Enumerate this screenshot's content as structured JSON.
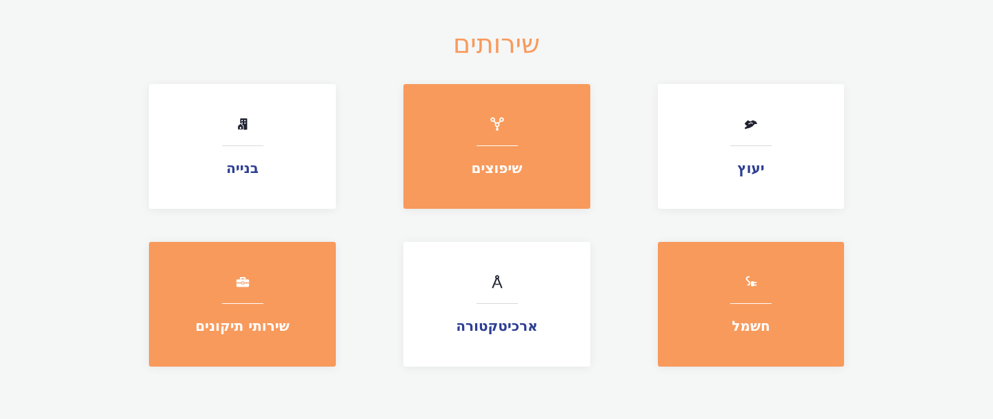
{
  "section": {
    "title": "שירותים"
  },
  "colors": {
    "accent": "#f89a5c",
    "title_blue": "#2d3e93",
    "card_white": "#ffffff",
    "background": "#f5f6f6"
  },
  "services": [
    {
      "title": "בנייה",
      "icon": "building-icon",
      "style": "white"
    },
    {
      "title": "שיפוצים",
      "icon": "nodes-icon",
      "style": "accent"
    },
    {
      "title": "יעוץ",
      "icon": "handshake-icon",
      "style": "white"
    },
    {
      "title": "שירותי תיקונים",
      "icon": "toolbox-icon",
      "style": "accent"
    },
    {
      "title": "ארכיטקטורה",
      "icon": "drafting-compass-icon",
      "style": "white"
    },
    {
      "title": "חשמל",
      "icon": "plug-icon",
      "style": "accent"
    }
  ]
}
